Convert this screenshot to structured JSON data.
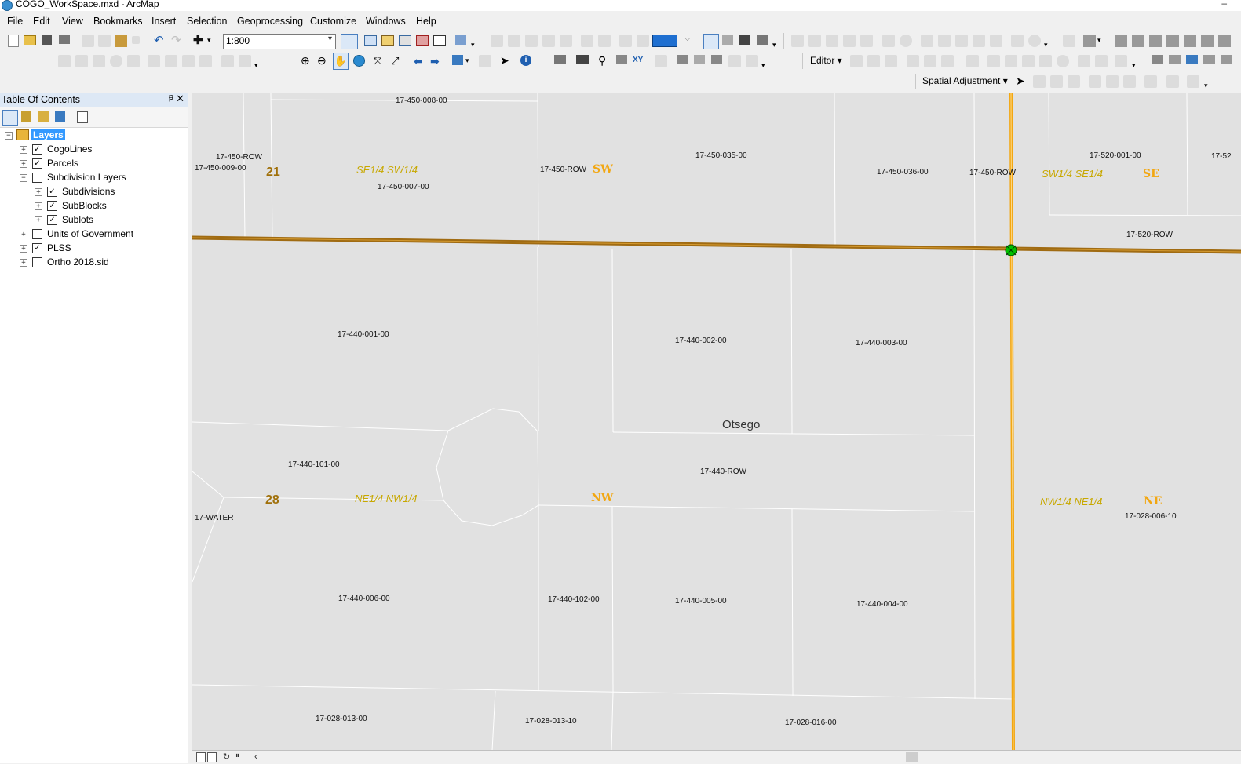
{
  "window": {
    "title": "COGO_WorkSpace.mxd - ArcMap",
    "minimize": "–"
  },
  "menu": [
    "File",
    "Edit",
    "View",
    "Bookmarks",
    "Insert",
    "Selection",
    "Geoprocessing",
    "Customize",
    "Windows",
    "Help"
  ],
  "toolbar": {
    "scale_value": "1:800",
    "editor_label": "Editor ▾",
    "spatial_adjustment_label": "Spatial Adjustment ▾"
  },
  "toc": {
    "title": "Table Of Contents",
    "pin": "ᵽ",
    "close": "✕",
    "layers": [
      {
        "label": "Layers",
        "checked": null,
        "expander": "−",
        "selected": true
      },
      {
        "label": "CogoLines",
        "checked": true,
        "expander": "+"
      },
      {
        "label": "Parcels",
        "checked": true,
        "expander": "+"
      },
      {
        "label": "Subdivision Layers",
        "checked": false,
        "expander": "−"
      },
      {
        "label": "Subdivisions",
        "checked": true,
        "expander": "+"
      },
      {
        "label": "SubBlocks",
        "checked": true,
        "expander": "+"
      },
      {
        "label": "Sublots",
        "checked": true,
        "expander": "+"
      },
      {
        "label": "Units of Government",
        "checked": false,
        "expander": "+"
      },
      {
        "label": "PLSS",
        "checked": true,
        "expander": "+"
      },
      {
        "label": "Ortho 2018.sid",
        "checked": false,
        "expander": "+"
      }
    ]
  },
  "map": {
    "parcel_labels": [
      "17-450-008-00",
      "17-450-ROW",
      "17-450-009-00",
      "17-450-007-00",
      "17-450-ROW",
      "17-450-035-00",
      "17-450-036-00",
      "17-450-ROW",
      "17-520-001-00",
      "17-52",
      "17-520-ROW",
      "17-440-001-00",
      "17-440-002-00",
      "17-440-003-00",
      "17-440-101-00",
      "17-440-ROW",
      "17-WATER",
      "17-028-006-10",
      "17-440-006-00",
      "17-440-102-00",
      "17-440-005-00",
      "17-440-004-00",
      "17-028-013-00",
      "17-028-013-10",
      "17-028-016-00"
    ],
    "section_numbers": [
      "21",
      "28"
    ],
    "quarter_quarter_labels": [
      "SE1/4 SW1/4",
      "SW1/4 SE1/4",
      "NE1/4 NW1/4",
      "NW1/4 NE1/4"
    ],
    "quarter_labels": [
      "SW",
      "SE",
      "NW",
      "NE"
    ],
    "place_name": "Otsego",
    "colors": {
      "map_bg": "#e1e1e1",
      "parcel_line": "#ffffff",
      "cogo_line": "#a06b12",
      "plss_line": "#f2a712",
      "quarter_label": "#c8a800",
      "section_label": "#a0700a",
      "vertex": "#00c000"
    }
  }
}
